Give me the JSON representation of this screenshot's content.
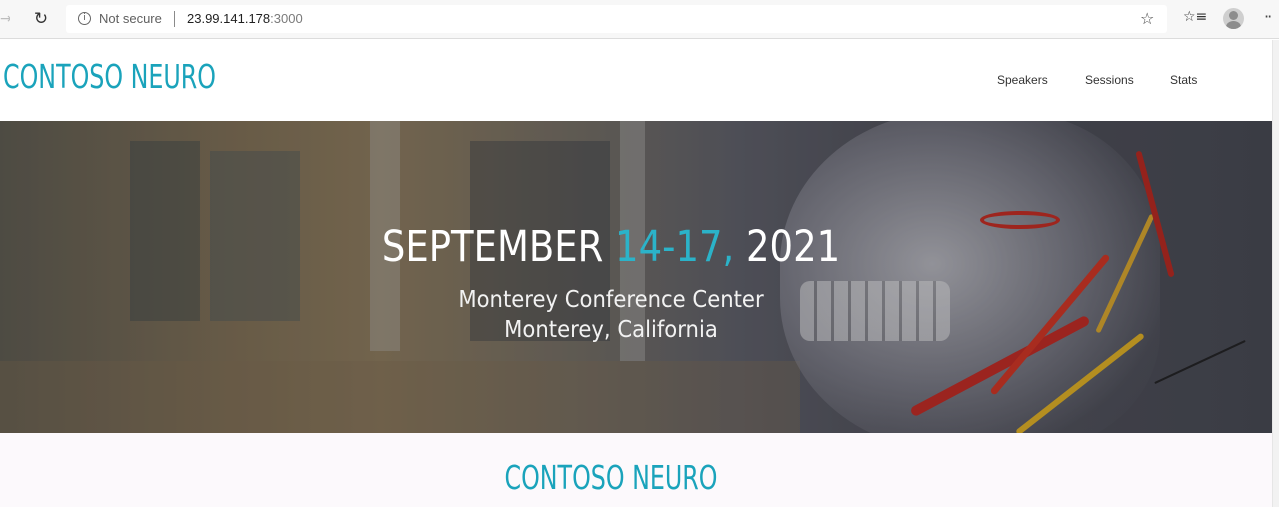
{
  "browser": {
    "security_label": "Not secure",
    "url_host": "23.99.141.178",
    "url_port": ":3000",
    "info_icon": "info-icon",
    "refresh_icon": "refresh-icon",
    "star_icon": "star-icon",
    "favorites_icon": "favorites-icon",
    "profile_icon": "profile-icon",
    "more_icon": "more-icon"
  },
  "header": {
    "logo": "CONTOSO NEURO",
    "nav": [
      {
        "label": "Speakers"
      },
      {
        "label": "Sessions"
      },
      {
        "label": "Stats"
      }
    ]
  },
  "hero": {
    "date_month": "SEPTEMBER ",
    "date_days": "14-17, ",
    "date_year": "2021",
    "venue_line1": "Monterey Conference Center",
    "venue_line2": "Monterey, California"
  },
  "section": {
    "title": "CONTOSO NEURO"
  },
  "colors": {
    "brand": "#1aa3bb",
    "accent": "#2bb3c9"
  }
}
